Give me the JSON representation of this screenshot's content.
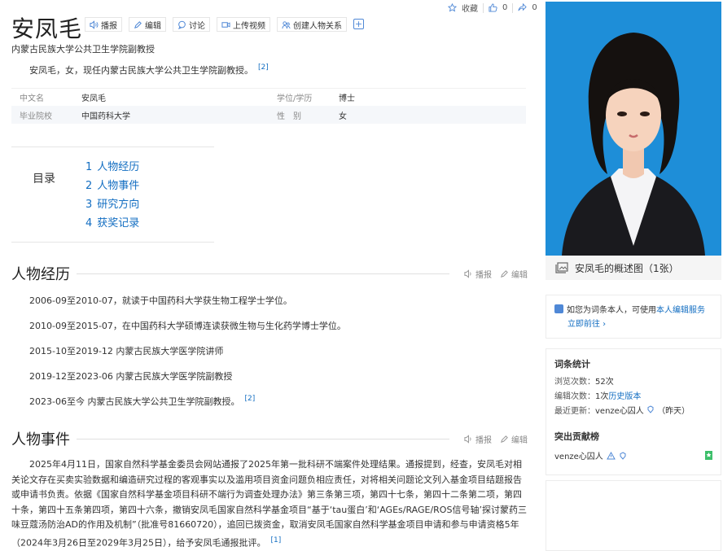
{
  "header": {
    "title": "安凤毛",
    "tools": [
      {
        "icon": "speaker-icon",
        "label": "播报"
      },
      {
        "icon": "edit-icon",
        "label": "编辑"
      },
      {
        "icon": "comment-icon",
        "label": "讨论"
      },
      {
        "icon": "video-icon",
        "label": "上传视频"
      },
      {
        "icon": "relation-icon",
        "label": "创建人物关系"
      }
    ],
    "add_label": "+",
    "favorite_label": "收藏",
    "like_count": "0",
    "share_count": "0",
    "subtitle": "内蒙古民族大学公共卫生学院副教授",
    "summary": "安凤毛，女，现任内蒙古民族大学公共卫生学院副教授。",
    "summary_ref": "[2]"
  },
  "info": {
    "rows": [
      {
        "k1": "中文名",
        "v1": "安凤毛",
        "k2": "学位/学历",
        "v2": "博士"
      },
      {
        "k1": "毕业院校",
        "v1": "中国药科大学",
        "k2": "性　别",
        "v2": "女"
      }
    ]
  },
  "toc": {
    "label": "目录",
    "items": [
      {
        "n": "1",
        "label": "人物经历"
      },
      {
        "n": "2",
        "label": "人物事件"
      },
      {
        "n": "3",
        "label": "研究方向"
      },
      {
        "n": "4",
        "label": "获奖记录"
      }
    ]
  },
  "section_actions": {
    "broadcast": "播报",
    "edit": "编辑"
  },
  "experience": {
    "title": "人物经历",
    "items": [
      "2006-09至2010-07，就读于中国药科大学获生物工程学士学位。",
      "2010-09至2015-07，在中国药科大学硕博连读获微生物与生化药学博士学位。",
      "2015-10至2019-12 内蒙古民族大学医学院讲师",
      "2019-12至2023-06 内蒙古民族大学医学院副教授",
      "2023-06至今 内蒙古民族大学公共卫生学院副教授。"
    ],
    "last_ref": "[2]"
  },
  "events": {
    "title": "人物事件",
    "text": "2025年4月11日，国家自然科学基金委员会网站通报了2025年第一批科研不端案件处理结果。通报提到，经查，安凤毛对相关论文存在买卖实验数据和编造研究过程的客观事实以及滥用项目资金问题负相应责任，对将相关问题论文列入基金项目结题报告或申请书负责。依据《国家自然科学基金项目科研不端行为调查处理办法》第三条第三项，第四十七条，第四十二条第二项，第四十条，第四十五条第四项，第四十六条，撤销安凤毛国家自然科学基金项目“基于‘tau蛋白’和‘AGEs/RAGE/ROS信号轴’探讨蒙药三味豆蔻汤防治AD的作用及机制”（批准号81660720），追回已拨资金，取消安凤毛国家自然科学基金项目申请和参与申请资格5年（2024年3月26日至2029年3月25日），给予安凤毛通报批评。",
    "ref": "[1]"
  },
  "sidebar": {
    "photo_caption": "安凤毛的概述图（1张）",
    "claim_prefix": "如您为词条本人，可使用",
    "claim_link": "本人编辑服务",
    "claim_go": "立即前往 ›",
    "stats_title": "词条统计",
    "views_label": "浏览次数：",
    "views": "52次",
    "edits_label": "编辑次数：",
    "edits": "1次",
    "history_link": "历史版本",
    "updated_label": "最近更新：",
    "updated_user": "venze心囚人",
    "updated_time": "（昨天）",
    "contrib_title": "突出贡献榜",
    "contrib_user": "venze心囚人"
  }
}
